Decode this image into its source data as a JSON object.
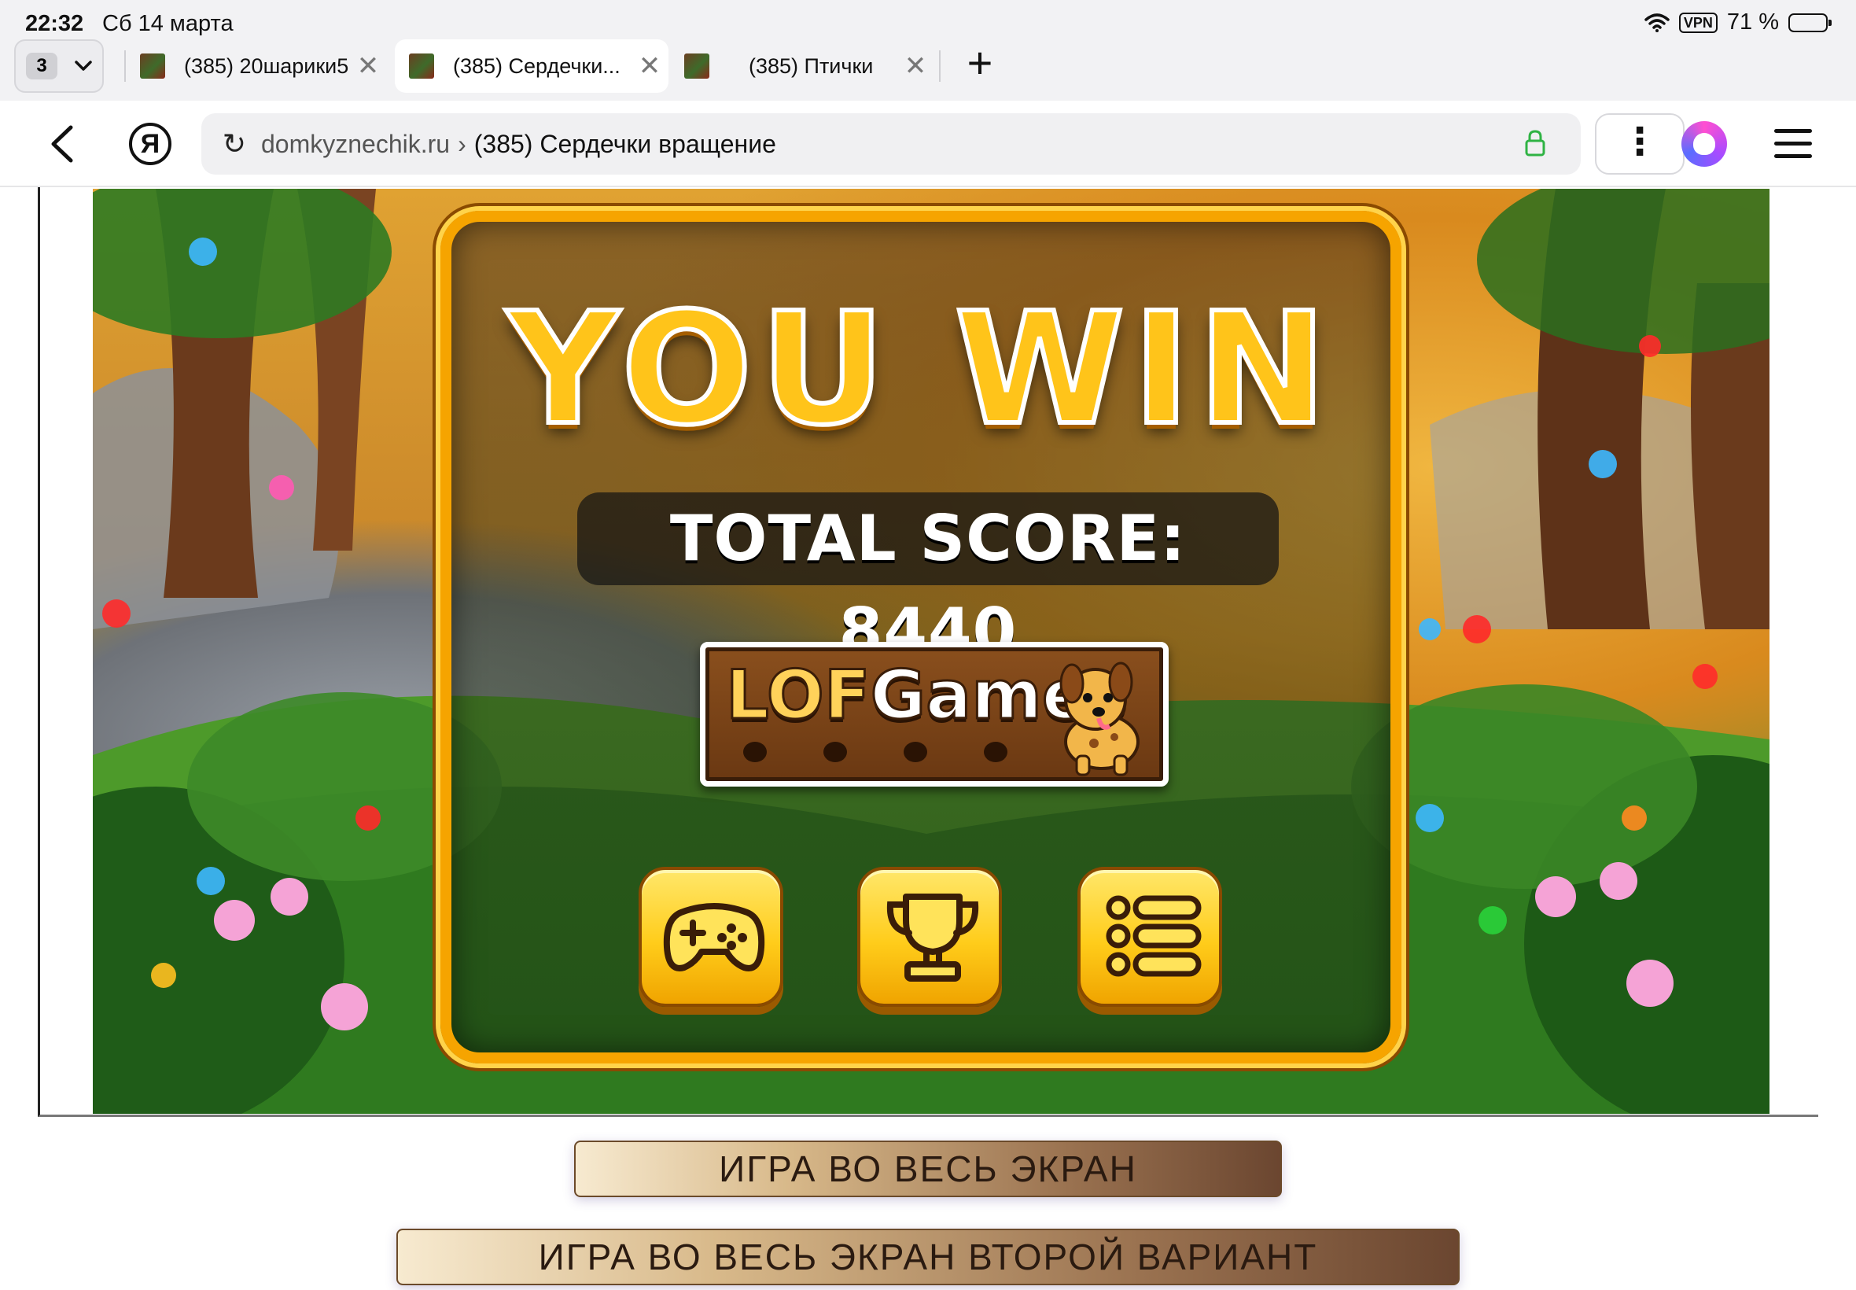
{
  "status_bar": {
    "time": "22:32",
    "date": "Сб 14 марта",
    "vpn": "VPN",
    "battery": "71 %",
    "battery_level": 0.71
  },
  "tabs": {
    "count": "3",
    "items": [
      {
        "title": "(385) 20шарики5",
        "active": false
      },
      {
        "title": "(385) Сердечки...",
        "active": true
      },
      {
        "title": "(385) Птички",
        "active": false
      }
    ]
  },
  "address_bar": {
    "domain": "domkyznechik.ru",
    "separator": "›",
    "page_title": "(385) Сердечки вращение",
    "lock_color": "#2fb344"
  },
  "game": {
    "title": "YOU WIN",
    "score_label": "TOTAL SCORE: 8440",
    "brand_lo": "L",
    "brand_o": "O",
    "brand_f": "F",
    "brand_games": "Games",
    "accent": "#f6a400",
    "buttons": [
      {
        "name": "play",
        "icon": "gamepad-icon"
      },
      {
        "name": "leaderboard",
        "icon": "trophy-icon"
      },
      {
        "name": "menu",
        "icon": "list-icon"
      }
    ]
  },
  "page_buttons": {
    "fullscreen": "ИГРА ВО ВЕСЬ ЭКРАН",
    "fullscreen_alt": "ИГРА ВО ВЕСЬ ЭКРАН ВТОРОЙ ВАРИАНТ"
  }
}
